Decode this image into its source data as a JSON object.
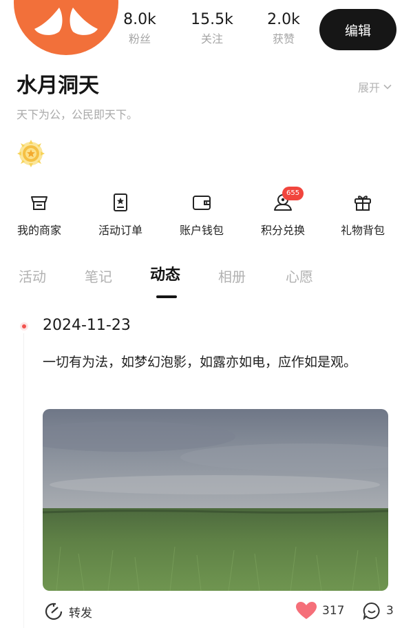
{
  "profile": {
    "stats": [
      {
        "value": "8.0k",
        "label": "粉丝"
      },
      {
        "value": "15.5k",
        "label": "关注"
      },
      {
        "value": "2.0k",
        "label": "获赞"
      }
    ],
    "edit_label": "编辑",
    "name": "水月洞天",
    "expand_label": "展开",
    "bio": "天下为公，公民即天下。"
  },
  "services": [
    {
      "label": "我的商家",
      "icon": "store-icon"
    },
    {
      "label": "活动订单",
      "icon": "ticket-icon"
    },
    {
      "label": "账户钱包",
      "icon": "wallet-icon"
    },
    {
      "label": "积分兑换",
      "icon": "points-exchange-icon",
      "badge": "655"
    },
    {
      "label": "礼物背包",
      "icon": "gift-icon"
    }
  ],
  "tabs": [
    {
      "label": "活动",
      "active": false
    },
    {
      "label": "笔记",
      "active": false
    },
    {
      "label": "动态",
      "active": true
    },
    {
      "label": "相册",
      "active": false
    },
    {
      "label": "心愿",
      "active": false
    }
  ],
  "post": {
    "date": "2024-11-23",
    "text": "一切有为法，如梦幻泡影，如露亦如电，应作如是观。",
    "actions": {
      "share_label": "转发",
      "likes": "317",
      "comments": "3"
    }
  },
  "colors": {
    "avatar": "#f2703a",
    "edit_button": "#161616",
    "points_badge": "#f1453d",
    "like_heart": "#f56f79",
    "timeline_dot": "#f2534e"
  }
}
